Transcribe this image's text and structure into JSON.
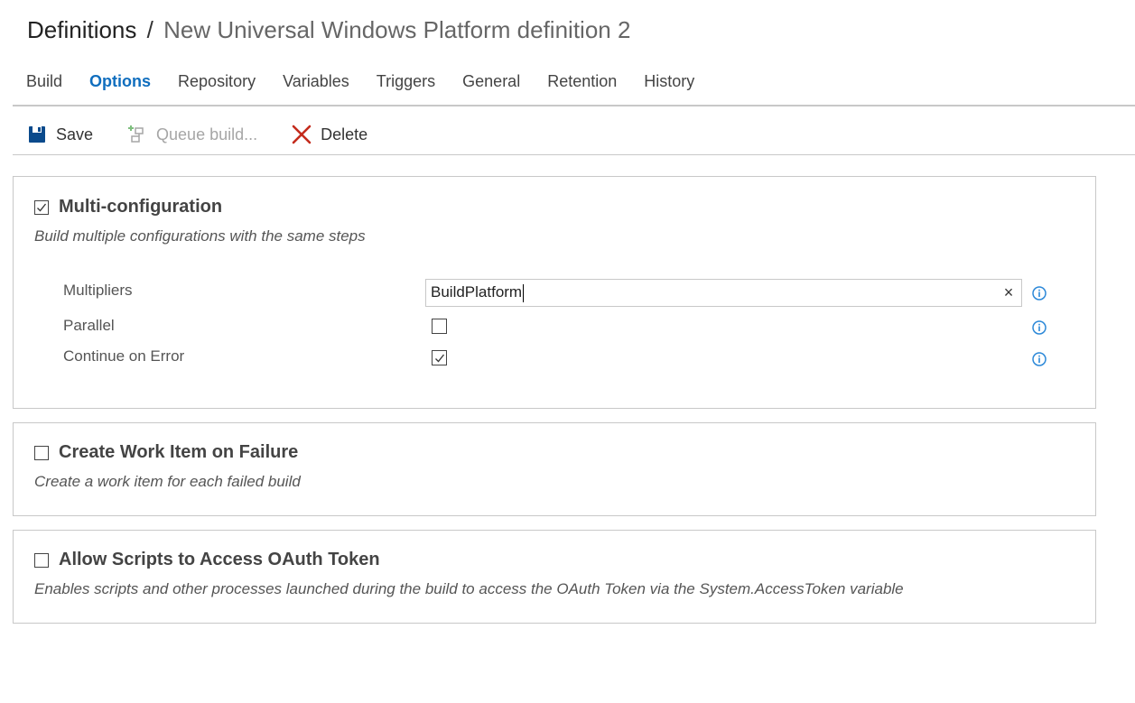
{
  "breadcrumb": {
    "root": "Definitions",
    "separator": "/",
    "current": "New Universal Windows Platform definition 2"
  },
  "tabs": [
    {
      "label": "Build",
      "active": false
    },
    {
      "label": "Options",
      "active": true
    },
    {
      "label": "Repository",
      "active": false
    },
    {
      "label": "Variables",
      "active": false
    },
    {
      "label": "Triggers",
      "active": false
    },
    {
      "label": "General",
      "active": false
    },
    {
      "label": "Retention",
      "active": false
    },
    {
      "label": "History",
      "active": false
    }
  ],
  "toolbar": {
    "save_label": "Save",
    "queue_label": "Queue build...",
    "delete_label": "Delete"
  },
  "multi_config": {
    "title": "Multi-configuration",
    "checked": true,
    "description": "Build multiple configurations with the same steps",
    "multipliers_label": "Multipliers",
    "multipliers_value": "BuildPlatform",
    "parallel_label": "Parallel",
    "parallel_checked": false,
    "continue_label": "Continue on Error",
    "continue_checked": true
  },
  "work_item": {
    "title": "Create Work Item on Failure",
    "checked": false,
    "description": "Create a work item for each failed build"
  },
  "oauth": {
    "title": "Allow Scripts to Access OAuth Token",
    "checked": false,
    "description": "Enables scripts and other processes launched during the build to access the OAuth Token via the System.AccessToken variable"
  },
  "colors": {
    "accent": "#106ebe",
    "info_icon": "#2b88d8",
    "delete_icon": "#c42b1c",
    "border": "#c8c8c8"
  }
}
